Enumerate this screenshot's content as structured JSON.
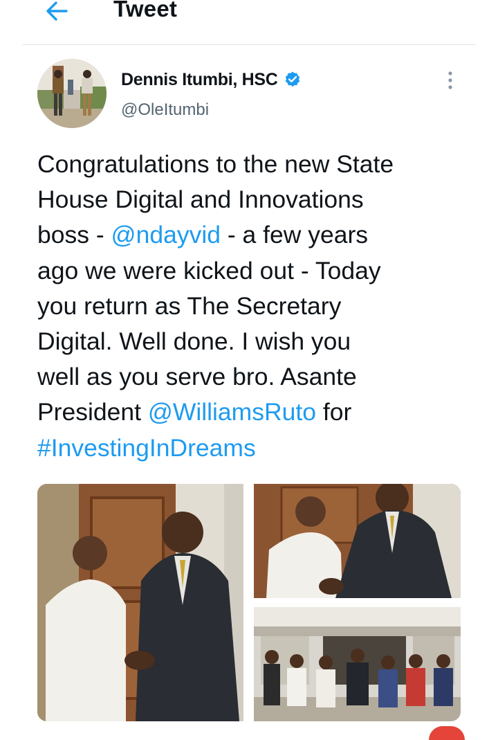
{
  "header": {
    "title": "Tweet",
    "back_icon": "arrow-left-icon"
  },
  "author": {
    "name": "Dennis Itumbi, HSC",
    "handle": "@OleItumbi",
    "verified_icon": "verified-badge-icon"
  },
  "tweet": {
    "text_before_mention1": "Congratulations to the new State\nHouse Digital and Innovations\nboss - ",
    "mention1": "@ndayvid",
    "text_middle": " - a few years\nago we were kicked out - Today\nyou return as The Secretary\nDigital. Well done. I wish you\nwell as you serve bro. Asante\nPresident ",
    "mention2": "@WilliamsRuto",
    "text_after_mention2": " for\n",
    "hashtag": "#InvestingInDreams"
  },
  "colors": {
    "link": "#1d9bf0",
    "verified": "#1d9bf0",
    "handle": "#536471",
    "divider": "#e1e6ea",
    "fab": "#e4443a"
  }
}
